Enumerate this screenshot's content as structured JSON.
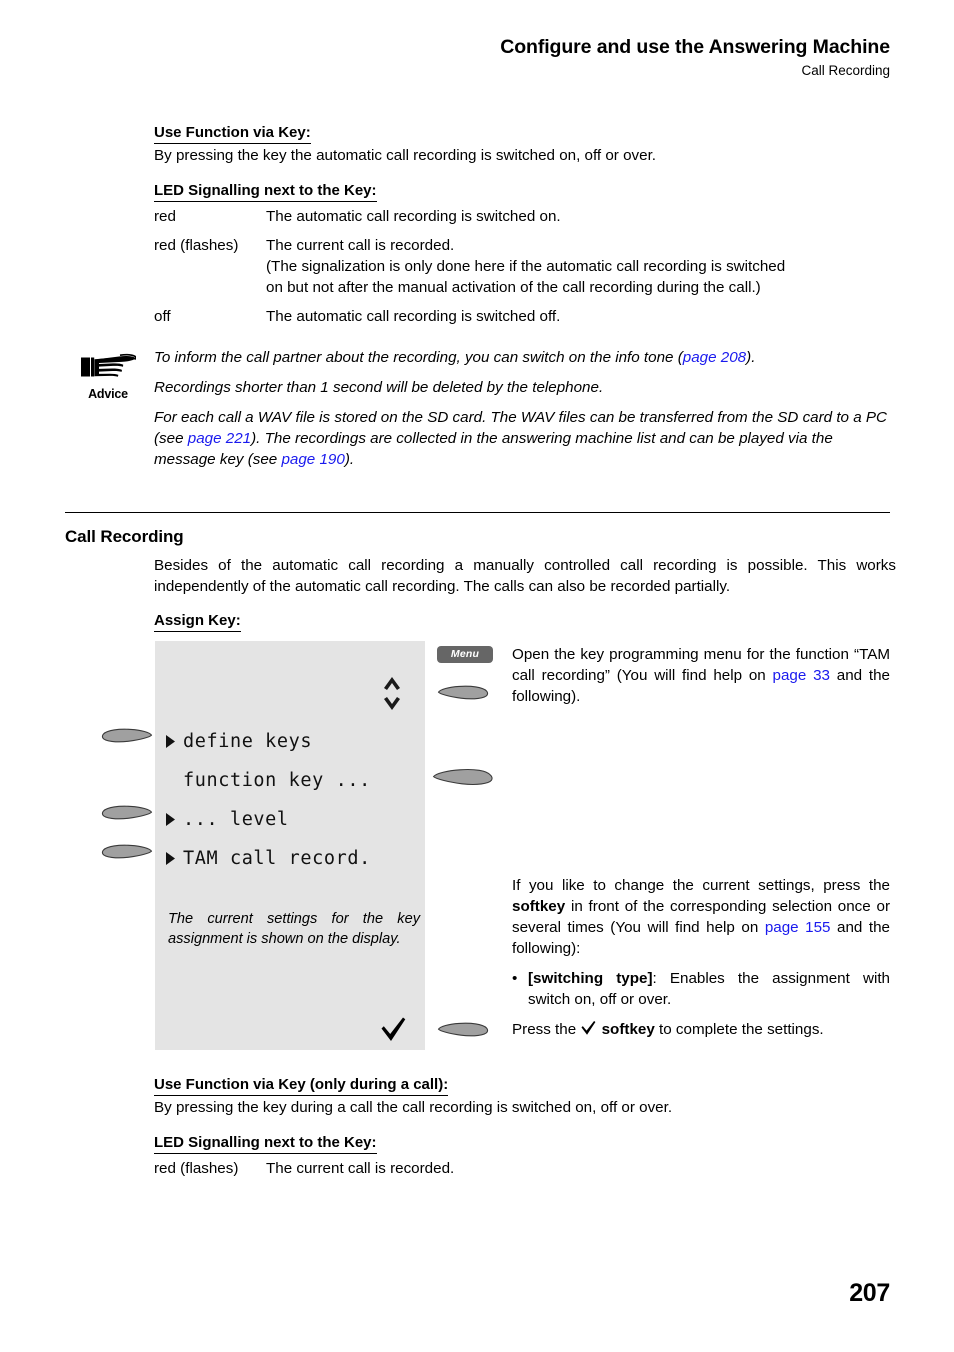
{
  "header": {
    "title": "Configure and use the Answering Machine",
    "subtitle": "Call Recording"
  },
  "section_top": {
    "use_function_heading": "Use Function via Key:",
    "use_function_text": "By pressing the key the automatic call recording is switched on, off or over.",
    "led_heading": "LED Signalling next to the Key:",
    "led_rows": [
      {
        "state": "red",
        "desc": "The automatic call recording is switched on."
      },
      {
        "state": "red (flashes)",
        "desc": "The current call is recorded.",
        "desc2": "(The signalization is only done here if the automatic call recording is switched",
        "desc3": "on but not after the manual activation of the call recording during the call.)"
      },
      {
        "state": "off",
        "desc": "The automatic call recording is switched off."
      }
    ]
  },
  "advice": {
    "label": "Advice",
    "icon": "pointing-hand-icon",
    "para1_a": "To inform the call partner about the recording, you can switch on the info tone (",
    "para1_link": "page 208",
    "para1_b": ").",
    "para2": "Recordings shorter than 1 second will be deleted by the telephone.",
    "para3_a": "For each call a WAV file is stored on the SD card. The WAV files can be transferred from the SD card to a PC (see ",
    "para3_link1": "page 221",
    "para3_b": "). The recordings are collected in the answering machine list and can be played via the message key (see ",
    "para3_link2": "page 190",
    "para3_c": ")."
  },
  "section": {
    "title": "Call Recording",
    "intro": "Besides of the automatic call recording a manually controlled call recording is possible. This works independently of the automatic call recording. The calls can also be recorded partially.",
    "assign_key_heading": "Assign Key:"
  },
  "display": {
    "chevron_up": "chevron-up-icon",
    "chevron_down": "chevron-down-icon",
    "lines": [
      {
        "arrow": true,
        "text": "define keys"
      },
      {
        "arrow": false,
        "text": "function key ..."
      },
      {
        "arrow": true,
        "text": "... level"
      },
      {
        "arrow": true,
        "text": "TAM call record."
      }
    ],
    "caption": "The current settings for the key assignment is shown on the display.",
    "check_icon": "checkmark-icon"
  },
  "keys": {
    "menu_label": "Menu",
    "softkey_icon": "softkey-icon"
  },
  "instructions": {
    "step1_a": "Open the key programming menu for the function “TAM call recording” (You will find help on ",
    "step1_link": "page 33",
    "step1_b": " and the following).",
    "step2_a": "If you like to change the current settings, press the ",
    "step2_bold": "softkey",
    "step2_b": " in front of the corresponding selection once or several times (You will find help on ",
    "step2_link": "page 155",
    "step2_c": " and the following):",
    "bullet_dot": "•",
    "bullet_bold": "[switching type]",
    "bullet_text": ": Enables the assignment with switch on, off or over.",
    "step3_a": "Press the ",
    "step3_bold": "softkey",
    "step3_b": " to complete the settings."
  },
  "section_bottom": {
    "use_function_heading": "Use Function via Key (only during a call):",
    "use_function_text": "By pressing the key during a call the call recording is switched on, off or over.",
    "led_heading": "LED Signalling next to the Key:",
    "led_state": "red (flashes)",
    "led_desc": "The current call is recorded."
  },
  "page_number": "207",
  "colors": {
    "link": "#1a1aee",
    "lcd_bg": "#e4e4e4",
    "softkey_fill": "#a0a0a0",
    "menu_btn_bg": "#666666"
  }
}
